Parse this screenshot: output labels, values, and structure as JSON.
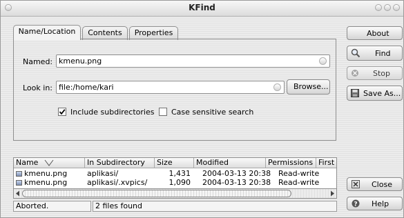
{
  "window": {
    "title": "KFind"
  },
  "tabs": [
    {
      "label": "Name/Location",
      "active": true
    },
    {
      "label": "Contents",
      "active": false
    },
    {
      "label": "Properties",
      "active": false
    }
  ],
  "form": {
    "named_label": "Named:",
    "named_value": "kmenu.png",
    "lookin_label": "Look in:",
    "lookin_value": "file:/home/kari",
    "browse_label": "Browse...",
    "include_subdirs_label": "Include subdirectories",
    "include_subdirs_checked": true,
    "case_sensitive_label": "Case sensitive search",
    "case_sensitive_checked": false
  },
  "side_buttons": {
    "about": "About",
    "find": "Find",
    "stop": "Stop",
    "save_as": "Save As...",
    "close": "Close",
    "help": "Help"
  },
  "results": {
    "columns": [
      "Name",
      "In Subdirectory",
      "Size",
      "Modified",
      "Permissions",
      "First"
    ],
    "rows": [
      {
        "name": "kmenu.png",
        "subdir": "aplikasi/",
        "size": "1,431",
        "modified": "2004-03-13 20:38",
        "permissions": "Read-write"
      },
      {
        "name": "kmenu.png",
        "subdir": "aplikasi/.xvpics/",
        "size": "1,090",
        "modified": "2004-03-13 20:38",
        "permissions": "Read-write"
      }
    ]
  },
  "statusbar": {
    "state": "Aborted.",
    "count": "2 files found"
  }
}
